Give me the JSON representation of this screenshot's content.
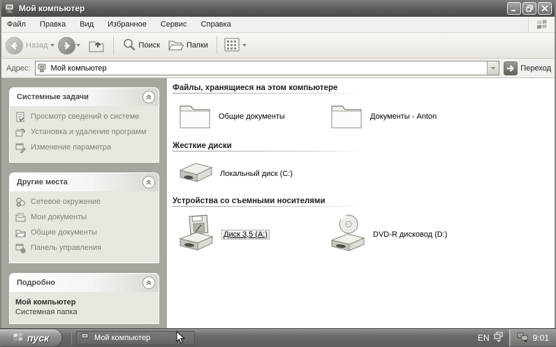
{
  "colors": {
    "titlebar": "#5a5a5a",
    "sidebar_bg": "#a6a69e",
    "content_bg": "#ffffff",
    "taskbar": "#6a6a6a"
  },
  "window": {
    "title": "Мой компьютер",
    "menu": [
      "Файл",
      "Правка",
      "Вид",
      "Избранное",
      "Сервис",
      "Справка"
    ],
    "toolbar": {
      "back": "Назад",
      "search": "Поиск",
      "folders": "Папки"
    },
    "address": {
      "label": "Адрес:",
      "value": "Мой компьютер",
      "go": "Переход"
    }
  },
  "sidebar": {
    "panels": [
      {
        "title": "Системные задачи",
        "items": [
          {
            "icon": "system-info-icon",
            "label": "Просмотр сведений о системе"
          },
          {
            "icon": "add-remove-programs-icon",
            "label": "Установка и удаление программ"
          },
          {
            "icon": "change-setting-icon",
            "label": "Изменение параметра"
          }
        ]
      },
      {
        "title": "Другие места",
        "items": [
          {
            "icon": "network-places-icon",
            "label": "Сетевое окружение"
          },
          {
            "icon": "my-documents-icon",
            "label": "Мои документы"
          },
          {
            "icon": "shared-documents-icon",
            "label": "Общие документы"
          },
          {
            "icon": "control-panel-icon",
            "label": "Панель управления"
          }
        ]
      },
      {
        "title": "Подробно",
        "details": {
          "name": "Мой компьютер",
          "type": "Системная папка"
        }
      }
    ]
  },
  "content": {
    "groups": [
      {
        "title": "Файлы, хранящиеся на этом компьютере",
        "items": [
          {
            "icon": "folder-icon",
            "label": "Общие документы"
          },
          {
            "icon": "folder-icon",
            "label": "Документы - Anton"
          }
        ]
      },
      {
        "title": "Жесткие диски",
        "items": [
          {
            "icon": "hard-disk-icon",
            "label": "Локальный диск (C:)"
          }
        ]
      },
      {
        "title": "Устройства со съемными носителями",
        "items": [
          {
            "icon": "floppy-drive-icon",
            "label": "Диск 3,5 (А:)",
            "selected": true
          },
          {
            "icon": "dvd-drive-icon",
            "label": "DVD-R дисковод (D:)"
          }
        ]
      }
    ]
  },
  "taskbar": {
    "start": "пуск",
    "tasks": [
      {
        "label": "Мой компьютер"
      }
    ],
    "tray": {
      "language": "EN",
      "time": "9:01"
    }
  }
}
